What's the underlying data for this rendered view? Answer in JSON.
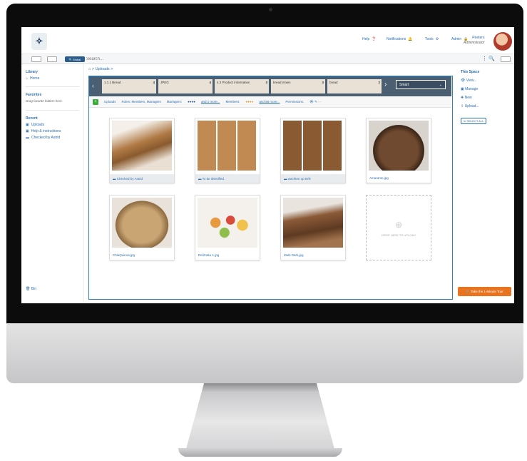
{
  "header": {
    "nav": [
      "Help",
      "Notifications",
      "Tools",
      "Admin"
    ],
    "user_name": "Peeters",
    "user_role": "Administrator"
  },
  "search": {
    "scope": "Global",
    "placeholder": "Search..."
  },
  "left": {
    "library": "Library",
    "home": "Home",
    "favorites": "Favorites",
    "favorites_note": "Drag favorite folders here.",
    "recent": "Recent",
    "recent_items": [
      "Uploads",
      "Help & instructions",
      "Checked by Astrid"
    ],
    "bin": "Bin"
  },
  "breadcrumb": {
    "root": "⌂ >",
    "current": "Uploads >"
  },
  "folders": [
    {
      "label": "1.1.1 Bread",
      "count": "4"
    },
    {
      "label": "JPEG",
      "count": "4"
    },
    {
      "label": "4.2 Product information",
      "count": "3"
    },
    {
      "label": "bread mixes",
      "count": "3"
    },
    {
      "label": "bread",
      "count": "2"
    }
  ],
  "view_select": "Smart",
  "toolbar": {
    "uploads": "Uploads",
    "roles": "Roles: Members, Managers",
    "managers": "Managers:",
    "managers_more": "and 2 more...",
    "members": "Members:",
    "members_more": "and 58 more...",
    "permissions": "Permissions:"
  },
  "tiles": [
    {
      "caption": "Checked by Astrid",
      "type": "folder"
    },
    {
      "caption": "To be identified",
      "type": "folder"
    },
    {
      "caption": "wachten op Erik",
      "type": "folder"
    },
    {
      "caption": "Amaranto.jpg",
      "type": "file"
    },
    {
      "caption": "ChiaQuinoa.jpg",
      "type": "file"
    },
    {
      "caption": "DeliCake 1.jpg",
      "type": "file"
    },
    {
      "caption": "Multi Dark.jpg",
      "type": "file"
    }
  ],
  "drop_text": "DROP HERE TO UPLOAD",
  "right": {
    "this_space": "This Space",
    "view": "View...",
    "manage": "Manage",
    "new": "New",
    "upload": "Upload...",
    "select_all": "SELECT ALL"
  },
  "tour_button": "Take the 1-Minute Tour"
}
